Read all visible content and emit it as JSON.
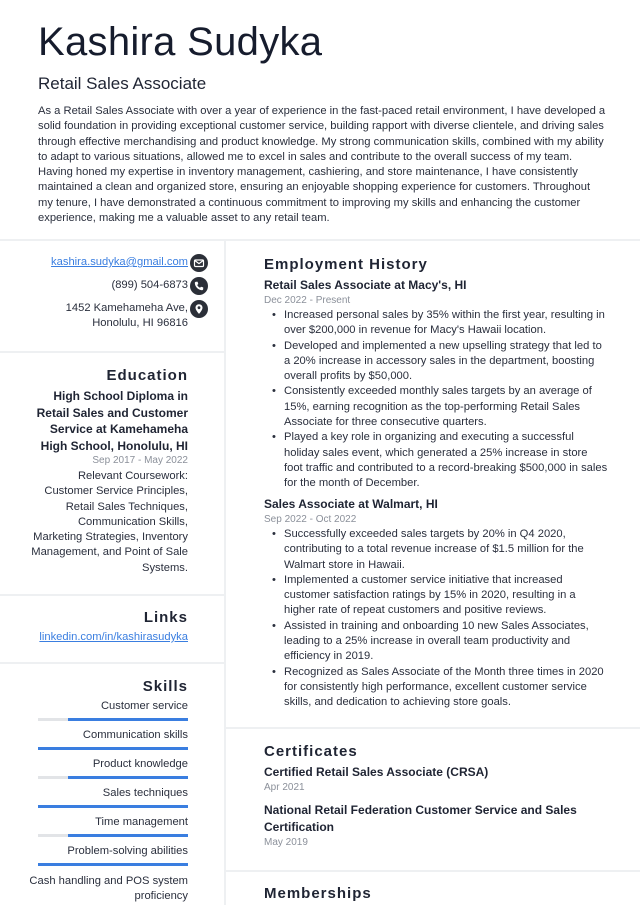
{
  "header": {
    "name": "Kashira Sudyka",
    "role": "Retail Sales Associate",
    "summary": "As a Retail Sales Associate with over a year of experience in the fast-paced retail environment, I have developed a solid foundation in providing exceptional customer service, building rapport with diverse clientele, and driving sales through effective merchandising and product knowledge. My strong communication skills, combined with my ability to adapt to various situations, allowed me to excel in sales and contribute to the overall success of my team. Having honed my expertise in inventory management, cashiering, and store maintenance, I have consistently maintained a clean and organized store, ensuring an enjoyable shopping experience for customers. Throughout my tenure, I have demonstrated a continuous commitment to improving my skills and enhancing the customer experience, making me a valuable asset to any retail team."
  },
  "contact": {
    "email": "kashira.sudyka@gmail.com",
    "email_icon": "envelope-icon",
    "phone": "(899) 504-6873",
    "phone_icon": "phone-icon",
    "address_line1": "1452 Kamehameha Ave,",
    "address_line2": "Honolulu, HI 96816",
    "address_icon": "map-pin-icon"
  },
  "education": {
    "title": "Education",
    "degree": "High School Diploma in Retail Sales and Customer Service at Kamehameha High School, Honolulu, HI",
    "date": "Sep 2017 - May 2022",
    "description": "Relevant Coursework: Customer Service Principles, Retail Sales Techniques, Communication Skills, Marketing Strategies, Inventory Management, and Point of Sale Systems."
  },
  "links": {
    "title": "Links",
    "items": [
      {
        "label": "linkedin.com/in/kashirasudyka"
      }
    ]
  },
  "skills": {
    "title": "Skills",
    "accent_color": "#3a7ee0",
    "track_color": "#e2e4e7",
    "items": [
      {
        "label": "Customer service",
        "level": 0.8
      },
      {
        "label": "Communication skills",
        "level": 1.0
      },
      {
        "label": "Product knowledge",
        "level": 0.8
      },
      {
        "label": "Sales techniques",
        "level": 1.0
      },
      {
        "label": "Time management",
        "level": 0.8
      },
      {
        "label": "Problem-solving abilities",
        "level": 1.0
      },
      {
        "label": "Cash handling and POS system proficiency"
      }
    ]
  },
  "employment": {
    "title": "Employment History",
    "jobs": [
      {
        "title": "Retail Sales Associate at Macy's, HI",
        "date": "Dec 2022 - Present",
        "bullets": [
          "Increased personal sales by 35% within the first year, resulting in over $200,000 in revenue for Macy's Hawaii location.",
          "Developed and implemented a new upselling strategy that led to a 20% increase in accessory sales in the department, boosting overall profits by $50,000.",
          "Consistently exceeded monthly sales targets by an average of 15%, earning recognition as the top-performing Retail Sales Associate for three consecutive quarters.",
          "Played a key role in organizing and executing a successful holiday sales event, which generated a 25% increase in store foot traffic and contributed to a record-breaking $500,000 in sales for the month of December."
        ]
      },
      {
        "title": "Sales Associate at Walmart, HI",
        "date": "Sep 2022 - Oct 2022",
        "bullets": [
          "Successfully exceeded sales targets by 20% in Q4 2020, contributing to a total revenue increase of $1.5 million for the Walmart store in Hawaii.",
          "Implemented a customer service initiative that increased customer satisfaction ratings by 15% in 2020, resulting in a higher rate of repeat customers and positive reviews.",
          "Assisted in training and onboarding 10 new Sales Associates, leading to a 25% increase in overall team productivity and efficiency in 2019.",
          "Recognized as Sales Associate of the Month three times in 2020 for consistently high performance, excellent customer service skills, and dedication to achieving store goals."
        ]
      }
    ]
  },
  "certificates": {
    "title": "Certificates",
    "items": [
      {
        "title": "Certified Retail Sales Associate (CRSA)",
        "date": "Apr 2021"
      },
      {
        "title": "National Retail Federation Customer Service and Sales Certification",
        "date": "May 2019"
      }
    ]
  },
  "memberships": {
    "title": "Memberships"
  }
}
